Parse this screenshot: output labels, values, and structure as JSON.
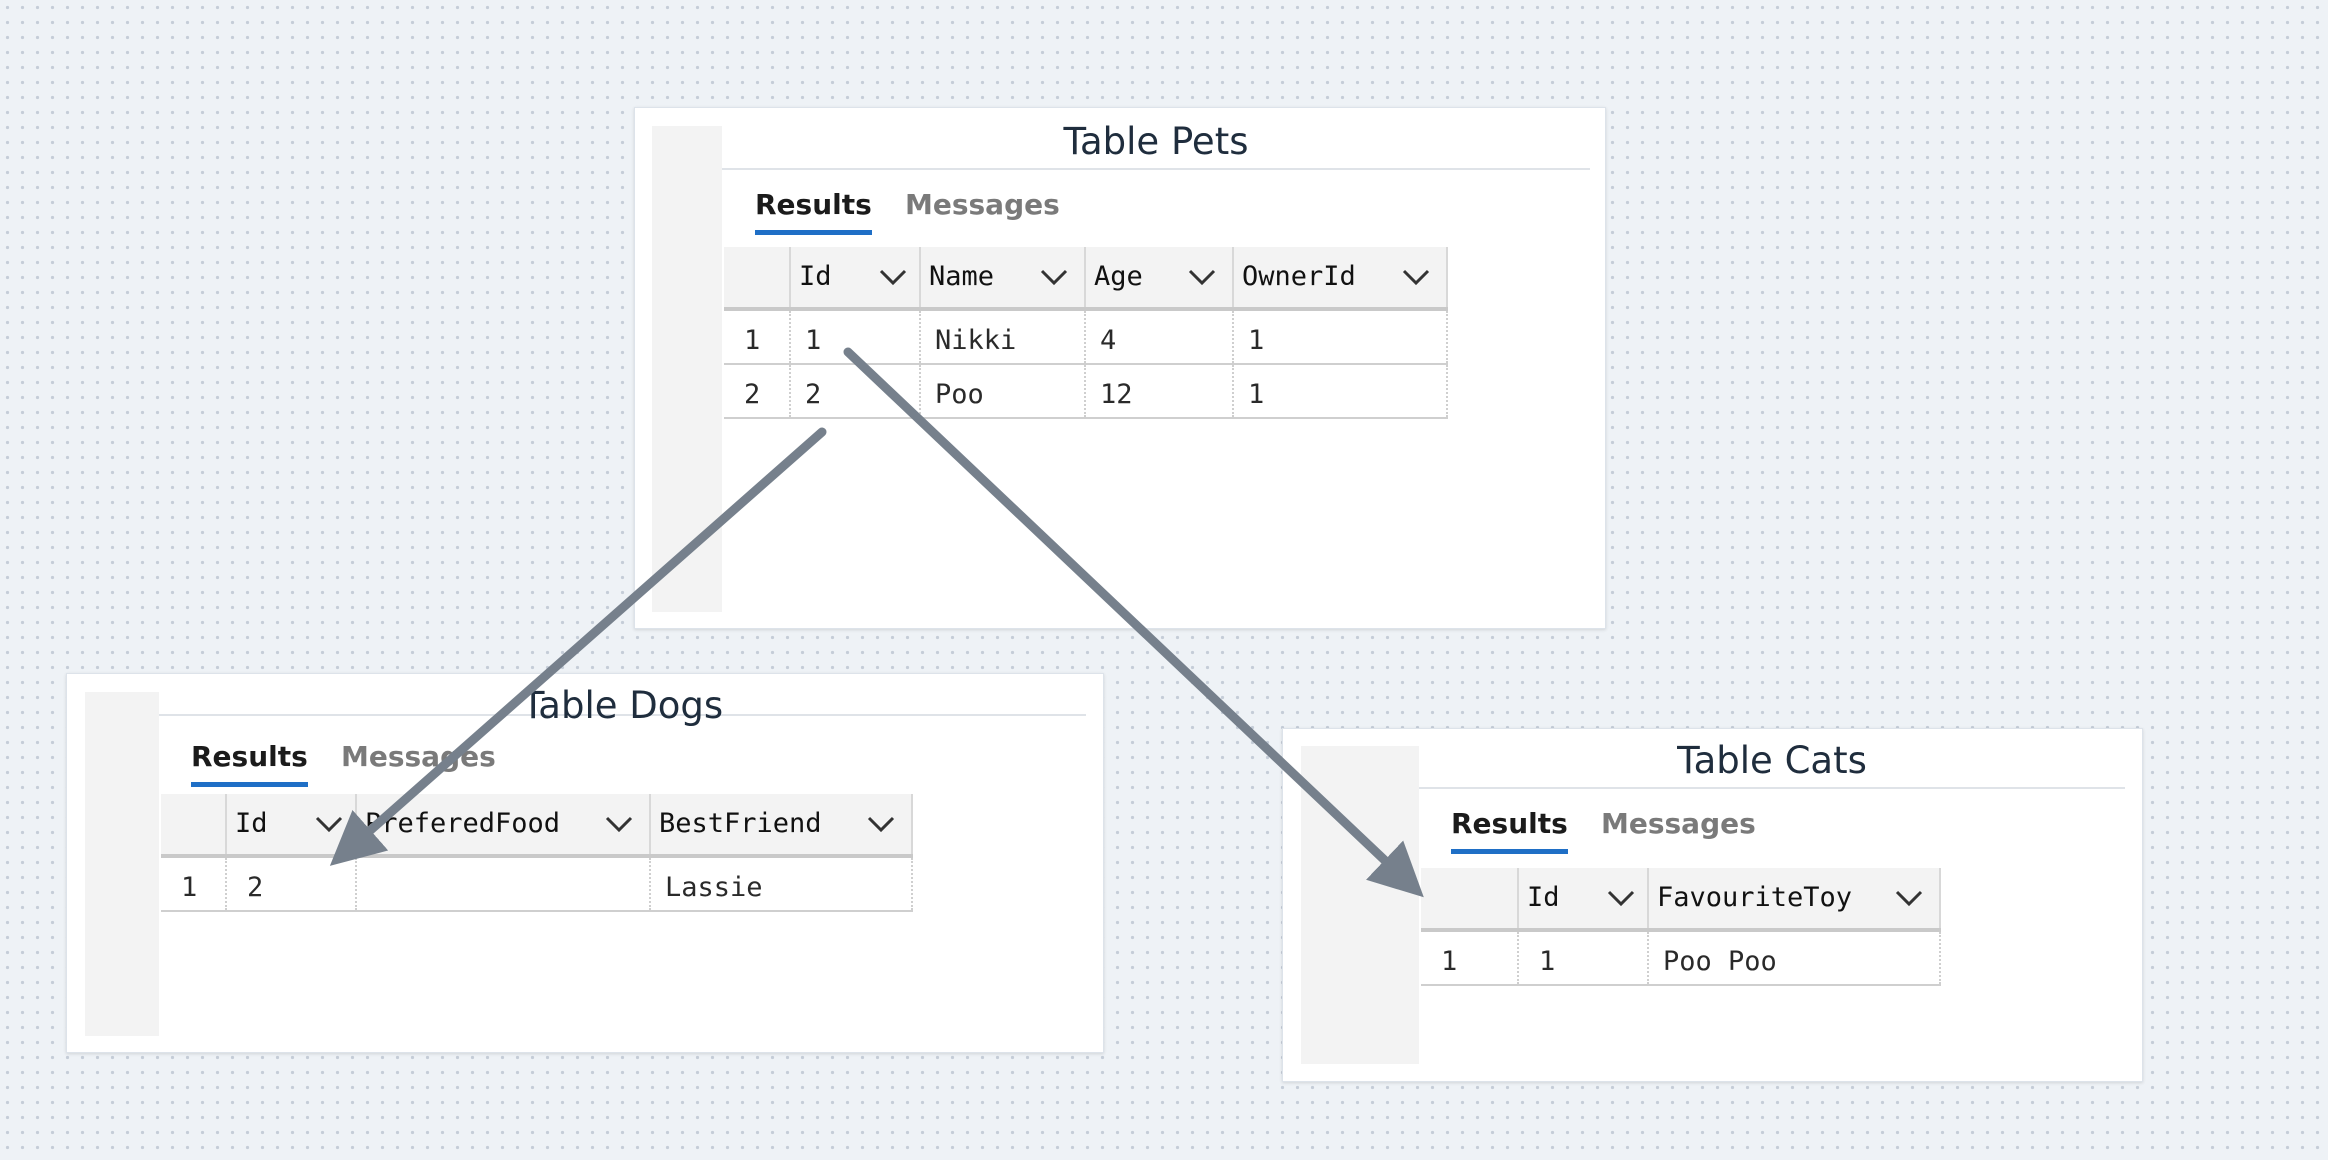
{
  "tabs": {
    "results": "Results",
    "messages": "Messages"
  },
  "colors": {
    "accent": "#1f6fc6",
    "arrow": "#76808c"
  },
  "icons": {
    "column_menu": "chevron-down-icon"
  },
  "pets": {
    "title": "Table Pets",
    "columns": [
      "Id",
      "Name",
      "Age",
      "OwnerId"
    ],
    "rows": [
      {
        "index": "1",
        "cells": [
          "1",
          "Nikki",
          "4",
          "1"
        ]
      },
      {
        "index": "2",
        "cells": [
          "2",
          "Poo",
          "12",
          "1"
        ]
      }
    ]
  },
  "dogs": {
    "title": "Table Dogs",
    "columns": [
      "Id",
      "PreferedFood",
      "BestFriend"
    ],
    "rows": [
      {
        "index": "1",
        "cells": [
          "2",
          "",
          "Lassie"
        ]
      }
    ]
  },
  "cats": {
    "title": "Table Cats",
    "columns": [
      "Id",
      "FavouriteToy"
    ],
    "rows": [
      {
        "index": "1",
        "cells": [
          "1",
          "Poo Poo"
        ]
      }
    ]
  }
}
